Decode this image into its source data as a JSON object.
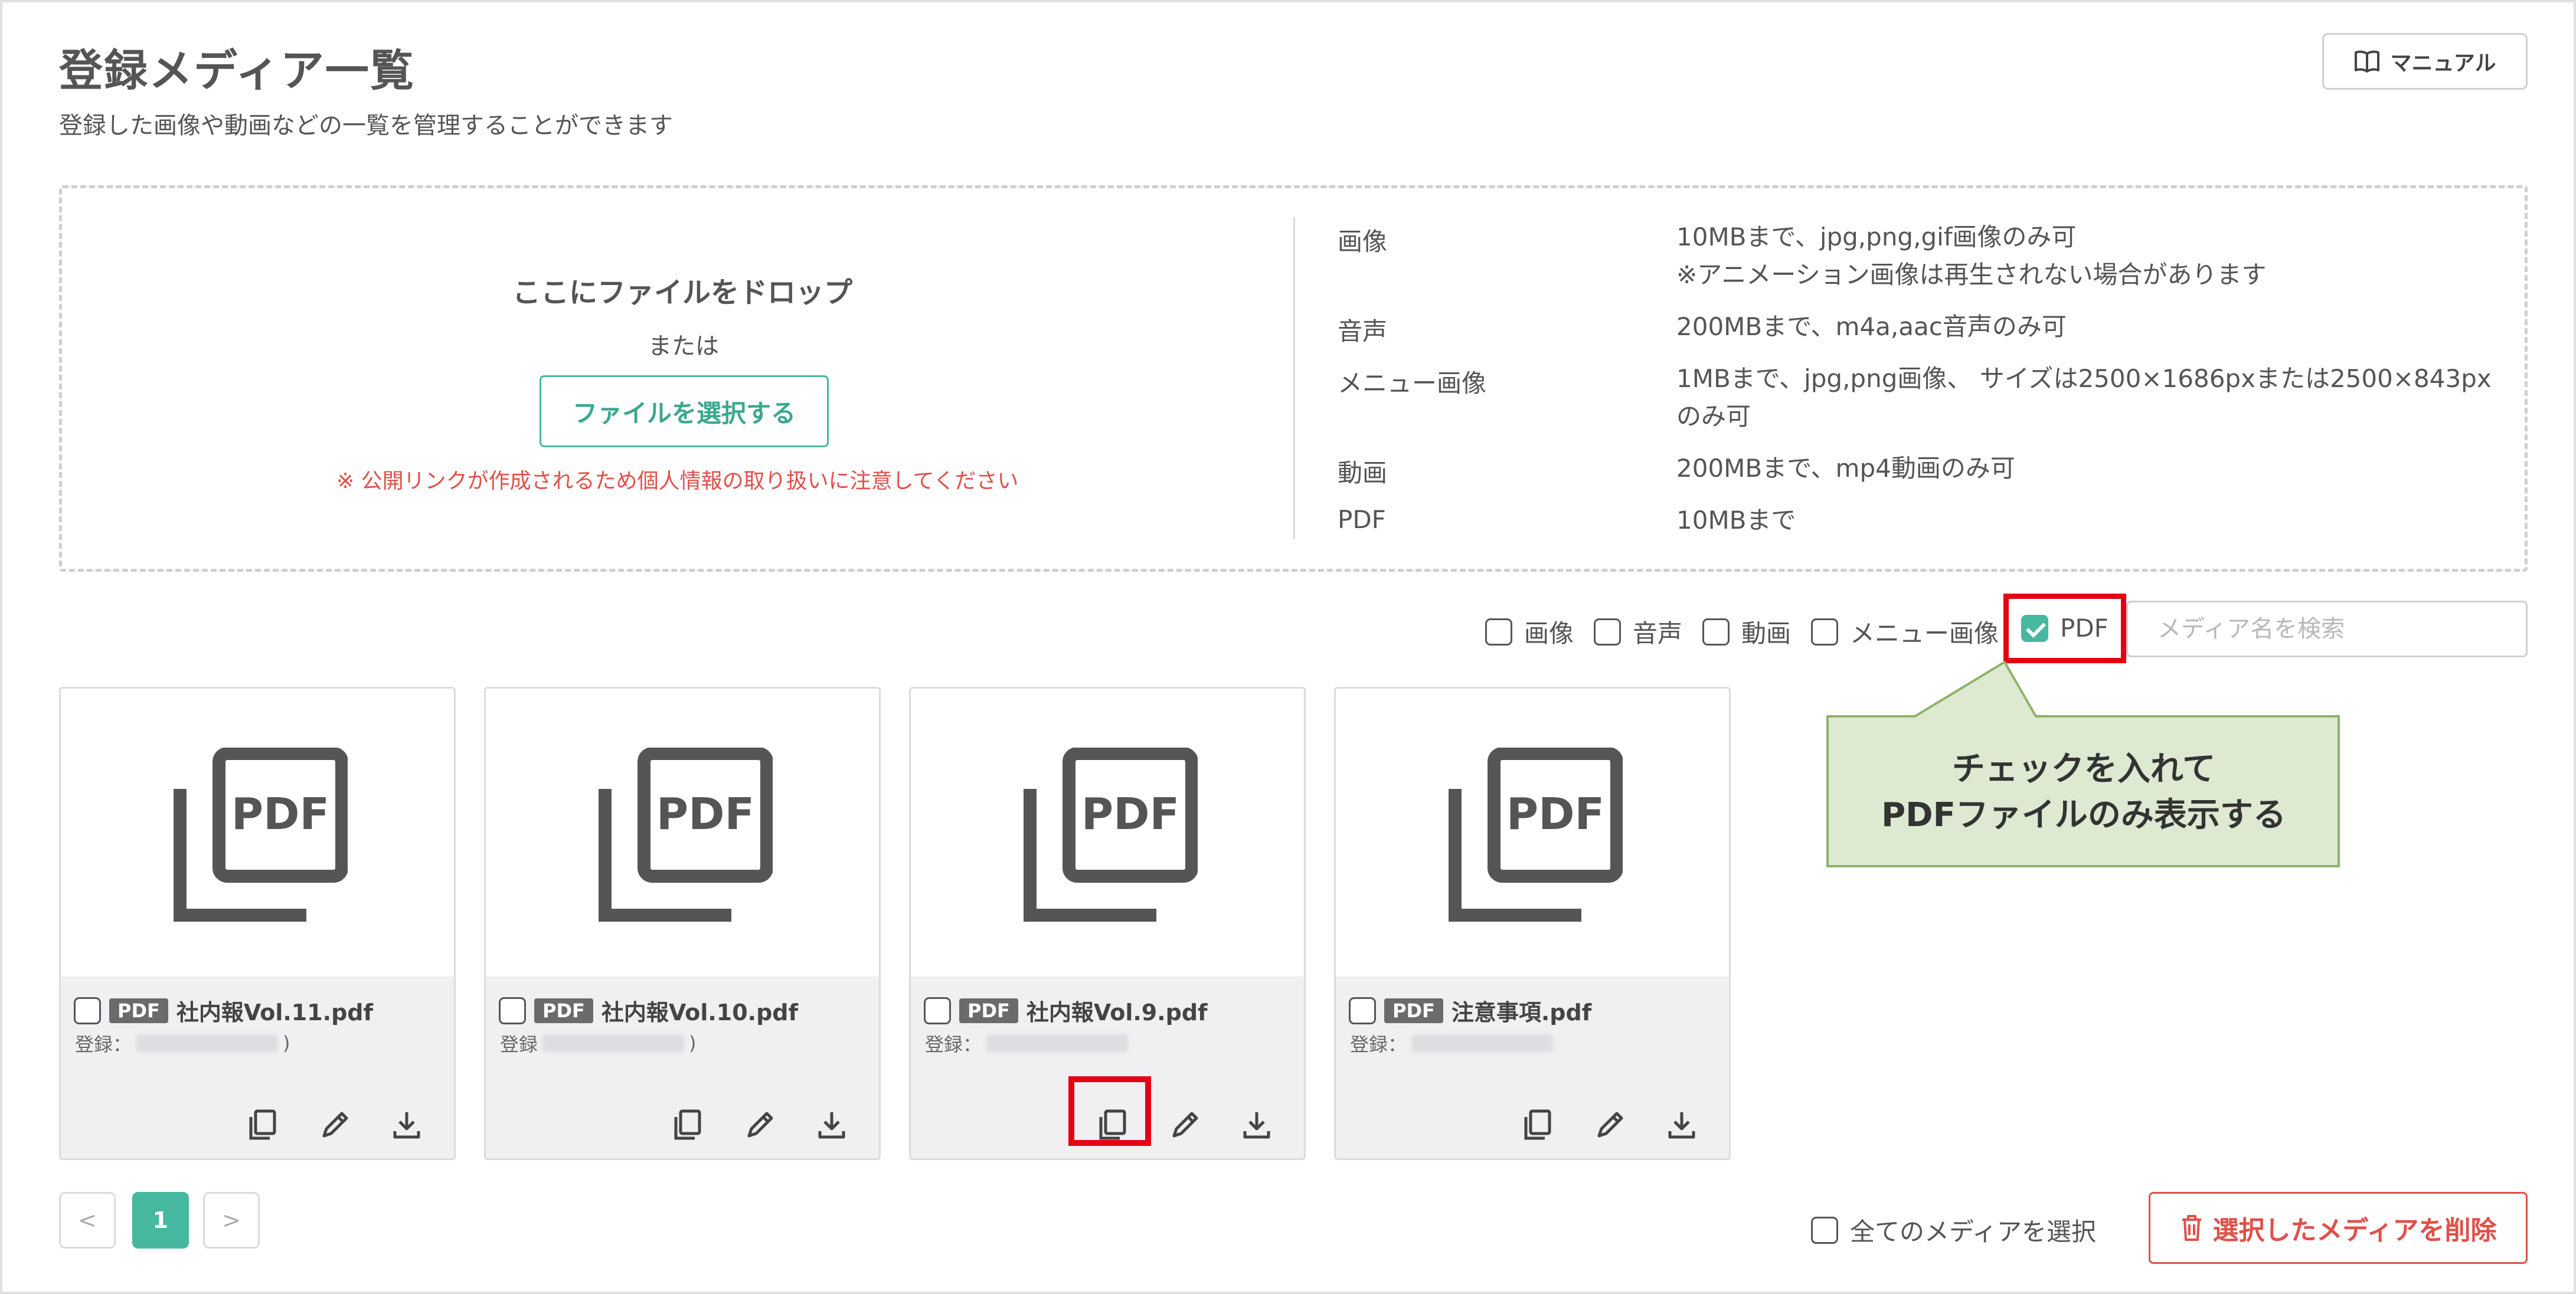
{
  "header": {
    "title": "登録メディア一覧",
    "subtitle": "登録した画像や動画などの一覧を管理することができます",
    "manual_label": "マニュアル"
  },
  "dropzone": {
    "title": "ここにファイルをドロップ",
    "or_text": "または",
    "select_button": "ファイルを選択する",
    "warning": "※ 公開リンクが作成されるため個人情報の取り扱いに注意してください"
  },
  "specs": [
    {
      "label": "画像",
      "lines": [
        "10MBまで、jpg,png,gif画像のみ可",
        "※アニメーション画像は再生されない場合があります"
      ]
    },
    {
      "label": "音声",
      "lines": [
        "200MBまで、m4a,aac音声のみ可"
      ]
    },
    {
      "label": "メニュー画像",
      "lines": [
        "1MBまで、jpg,png画像、 サイズは2500×1686pxまたは2500×843px",
        "のみ可"
      ]
    },
    {
      "label": "動画",
      "lines": [
        "200MBまで、mp4動画のみ可"
      ]
    },
    {
      "label": "PDF",
      "lines": [
        "10MBまで"
      ]
    }
  ],
  "filters": [
    {
      "label": "画像",
      "checked": false
    },
    {
      "label": "音声",
      "checked": false
    },
    {
      "label": "動画",
      "checked": false
    },
    {
      "label": "メニュー画像",
      "checked": false
    },
    {
      "label": "PDF",
      "checked": true
    }
  ],
  "search": {
    "placeholder": "メディア名を検索"
  },
  "cards": [
    {
      "badge": "PDF",
      "name": "社内報Vol.11.pdf",
      "reg_label": "登録：",
      "reg_tail": ")"
    },
    {
      "badge": "PDF",
      "name": "社内報Vol.10.pdf",
      "reg_label": "登録",
      "reg_tail": ")"
    },
    {
      "badge": "PDF",
      "name": "社内報Vol.9.pdf",
      "reg_label": "登録：",
      "reg_tail": ""
    },
    {
      "badge": "PDF",
      "name": "注意事項.pdf",
      "reg_label": "登録：",
      "reg_tail": ""
    }
  ],
  "thumbnail_text": "PDF",
  "callout": {
    "line1": "チェックを入れて",
    "line2": "PDFファイルのみ表示する"
  },
  "pagination": {
    "prev": "<",
    "current": "1",
    "next": ">"
  },
  "select_all_label": "全てのメディアを選択",
  "delete_button": "選択したメディアを削除",
  "colors": {
    "accent": "#46b8a0",
    "danger": "#e0504a",
    "highlight": "#e60012",
    "callout_bg": "#dde9d1"
  }
}
